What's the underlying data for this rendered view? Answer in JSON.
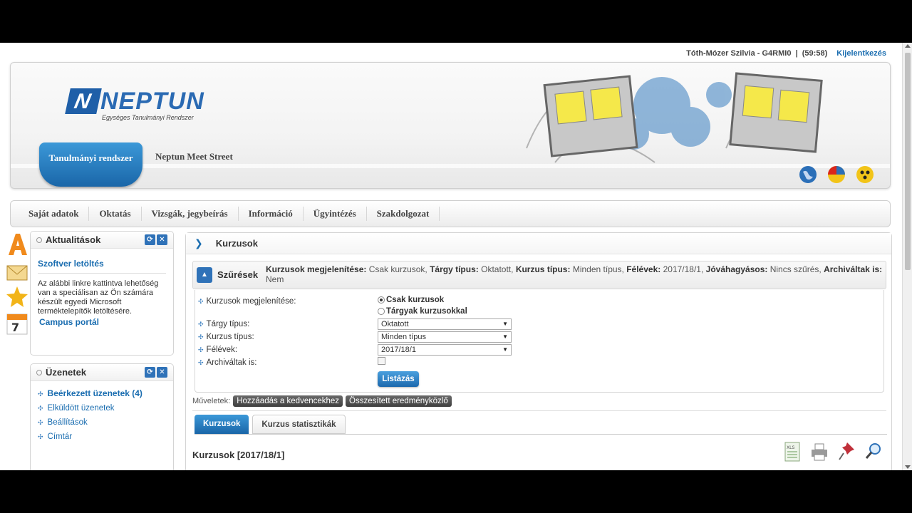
{
  "user": {
    "name": "Tóth-Mózer Szilvia - G4RMI0",
    "separator": "|",
    "session": "(59:58)",
    "logout": "Kijelentkezés"
  },
  "header": {
    "logo_word": "NEPTUN",
    "logo_mark": "N",
    "logo_sub": "Egységes Tanulmányi Rendszer",
    "system_tab": "Tanulmányi rendszer",
    "meet_street": "Neptun Meet Street"
  },
  "menu": [
    "Saját adatok",
    "Oktatás",
    "Vizsgák, jegybeírás",
    "Információ",
    "Ügyintézés",
    "Szakdolgozat"
  ],
  "news": {
    "title": "Aktualitások",
    "item_title": "Szoftver letöltés",
    "body": "Az alábbi linkre kattintva lehetőség van a speciálisan az Ön számára készült egyedi Microsoft terméktelepítők letöltésére.",
    "link": "Campus portál"
  },
  "messages": {
    "title": "Üzenetek",
    "items": [
      "Beérkezett üzenetek (4)",
      "Elküldött üzenetek",
      "Beállítások",
      "Címtár"
    ]
  },
  "main": {
    "breadcrumb": "Kurzusok",
    "filter_label": "Szűrések",
    "summary": {
      "k1": "Kurzusok megjelenítése:",
      "v1": "Csak kurzusok,",
      "k2": "Tárgy típus:",
      "v2": "Oktatott,",
      "k3": "Kurzus típus:",
      "v3": "Minden típus,",
      "k4": "Félévek:",
      "v4": "2017/18/1,",
      "k5": "Jóváhagyásos:",
      "v5": "Nincs szűrés,",
      "k6": "Archiváltak is:",
      "v6": "Nem"
    },
    "form": {
      "display_label": "Kurzusok megjelenítése:",
      "radio1": "Csak kurzusok",
      "radio2": "Tárgyak kurzusokkal",
      "subject_type_label": "Tárgy típus:",
      "subject_type_value": "Oktatott",
      "course_type_label": "Kurzus típus:",
      "course_type_value": "Minden típus",
      "semester_label": "Félévek:",
      "semester_value": "2017/18/1",
      "archived_label": "Archiváltak is:",
      "list_button": "Listázás"
    },
    "ops_label": "Műveletek:",
    "ops_buttons": [
      "Hozzáadás a kedvencekhez",
      "Összesített eredményközlő"
    ],
    "tabs": [
      "Kurzusok",
      "Kurzus statisztikák"
    ],
    "list_title": "Kurzusok [2017/18/1]"
  },
  "colors": {
    "accent": "#1a6db0",
    "brand_blue": "#2f72b8"
  }
}
